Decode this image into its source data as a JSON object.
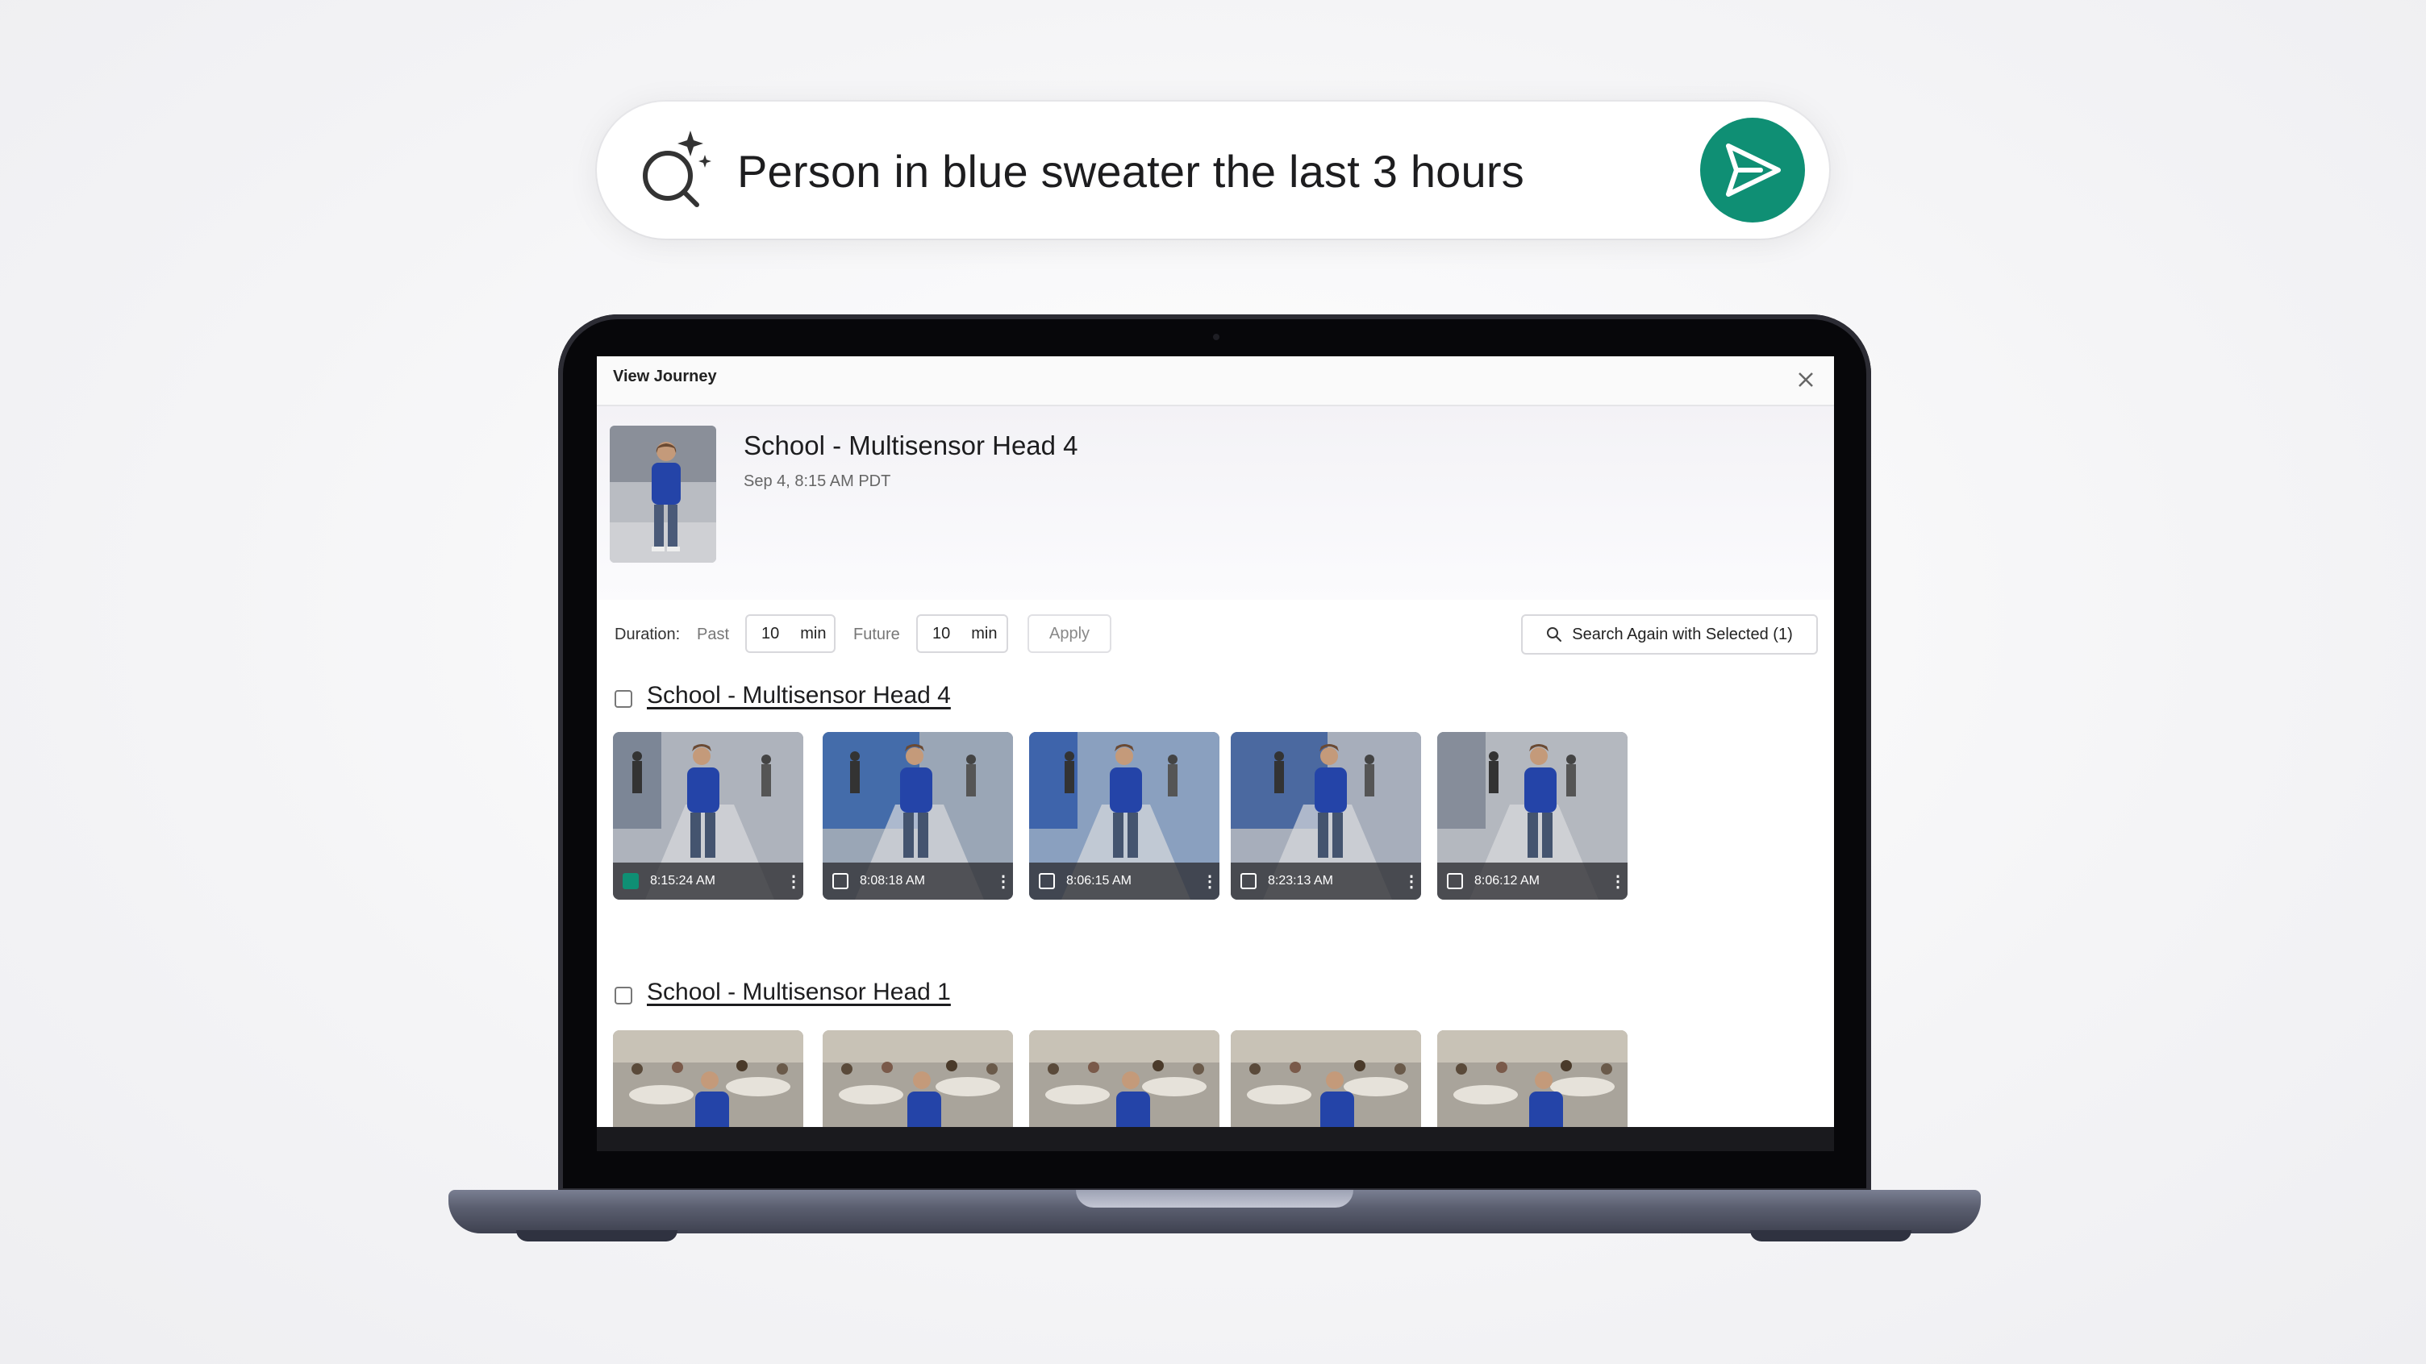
{
  "search": {
    "query": "Person in blue sweater the last 3 hours",
    "accent_color": "#0f8f74"
  },
  "window": {
    "title": "View Journey"
  },
  "header": {
    "camera_name": "School - Multisensor Head 4",
    "timestamp": "Sep 4, 8:15 AM PDT"
  },
  "controls": {
    "duration_label": "Duration:",
    "past_label": "Past",
    "past_value": "10",
    "past_unit": "min",
    "future_label": "Future",
    "future_value": "10",
    "future_unit": "min",
    "apply_label": "Apply",
    "search_again_label": "Search Again with Selected (1)"
  },
  "groups": [
    {
      "title": "School - Multisensor Head 4",
      "thumbnails": [
        {
          "time": "8:15:24 AM",
          "selected": true
        },
        {
          "time": "8:08:18 AM",
          "selected": false
        },
        {
          "time": "8:06:15 AM",
          "selected": false
        },
        {
          "time": "8:23:13 AM",
          "selected": false
        },
        {
          "time": "8:06:12 AM",
          "selected": false
        }
      ]
    },
    {
      "title": "School - Multisensor Head 1",
      "thumbnails": [
        {
          "time": "",
          "selected": false
        },
        {
          "time": "",
          "selected": false
        },
        {
          "time": "",
          "selected": false
        },
        {
          "time": "",
          "selected": false
        },
        {
          "time": "",
          "selected": false
        }
      ]
    }
  ]
}
